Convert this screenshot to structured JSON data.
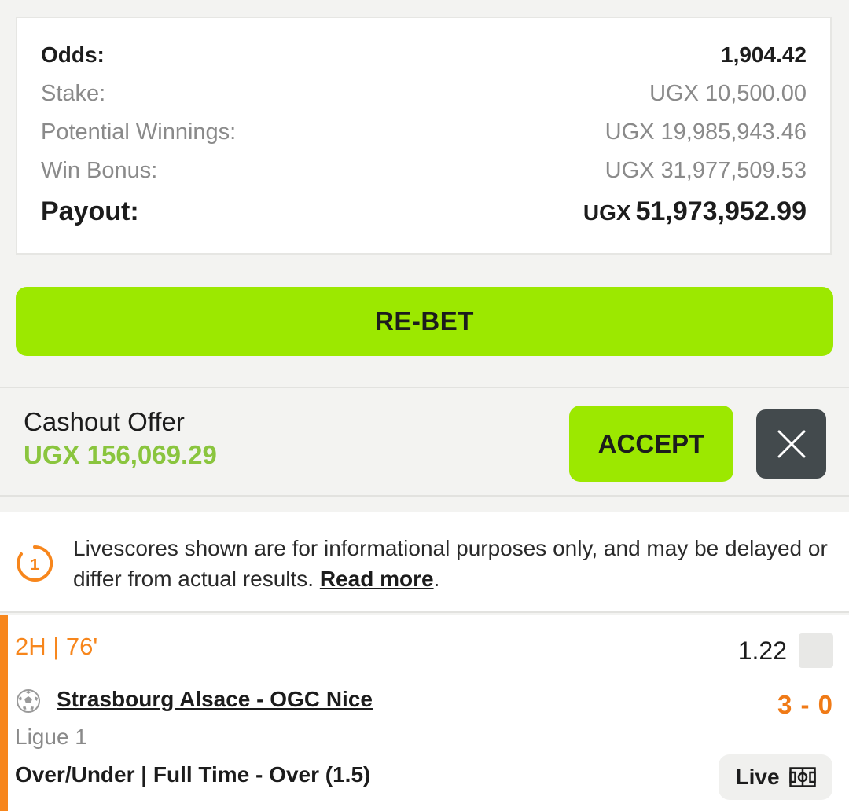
{
  "summary": {
    "odds_label": "Odds:",
    "odds_value": "1,904.42",
    "stake_label": "Stake:",
    "stake_value": "UGX 10,500.00",
    "potential_label": "Potential Winnings:",
    "potential_value": "UGX 19,985,943.46",
    "bonus_label": "Win Bonus:",
    "bonus_value": "UGX 31,977,509.53",
    "payout_label": "Payout:",
    "payout_currency": "UGX",
    "payout_value": "51,973,952.99"
  },
  "actions": {
    "rebet_label": "RE-BET"
  },
  "cashout": {
    "title": "Cashout Offer",
    "amount": "UGX 156,069.29",
    "accept_label": "ACCEPT",
    "close_icon": "close-icon"
  },
  "notice": {
    "icon": "info-timer-icon",
    "icon_text": "1",
    "text": "Livescores shown are for informational purposes only, and may be delayed or differ from actual results.",
    "link_text": "Read more",
    "suffix": "."
  },
  "selection": {
    "time": "2H | 76'",
    "odds": "1.22",
    "sport_icon": "soccer-ball-icon",
    "match": "Strasbourg Alsace - OGC Nice",
    "score": "3 - 0",
    "league": "Ligue 1",
    "market": "Over/Under | Full Time - Over (1.5)",
    "live_label": "Live",
    "live_icon": "pitch-icon"
  },
  "colors": {
    "accent_green": "#9ce800",
    "cashout_green": "#8ac53e",
    "live_orange": "#f7861c",
    "dark_button": "#434a4d"
  }
}
